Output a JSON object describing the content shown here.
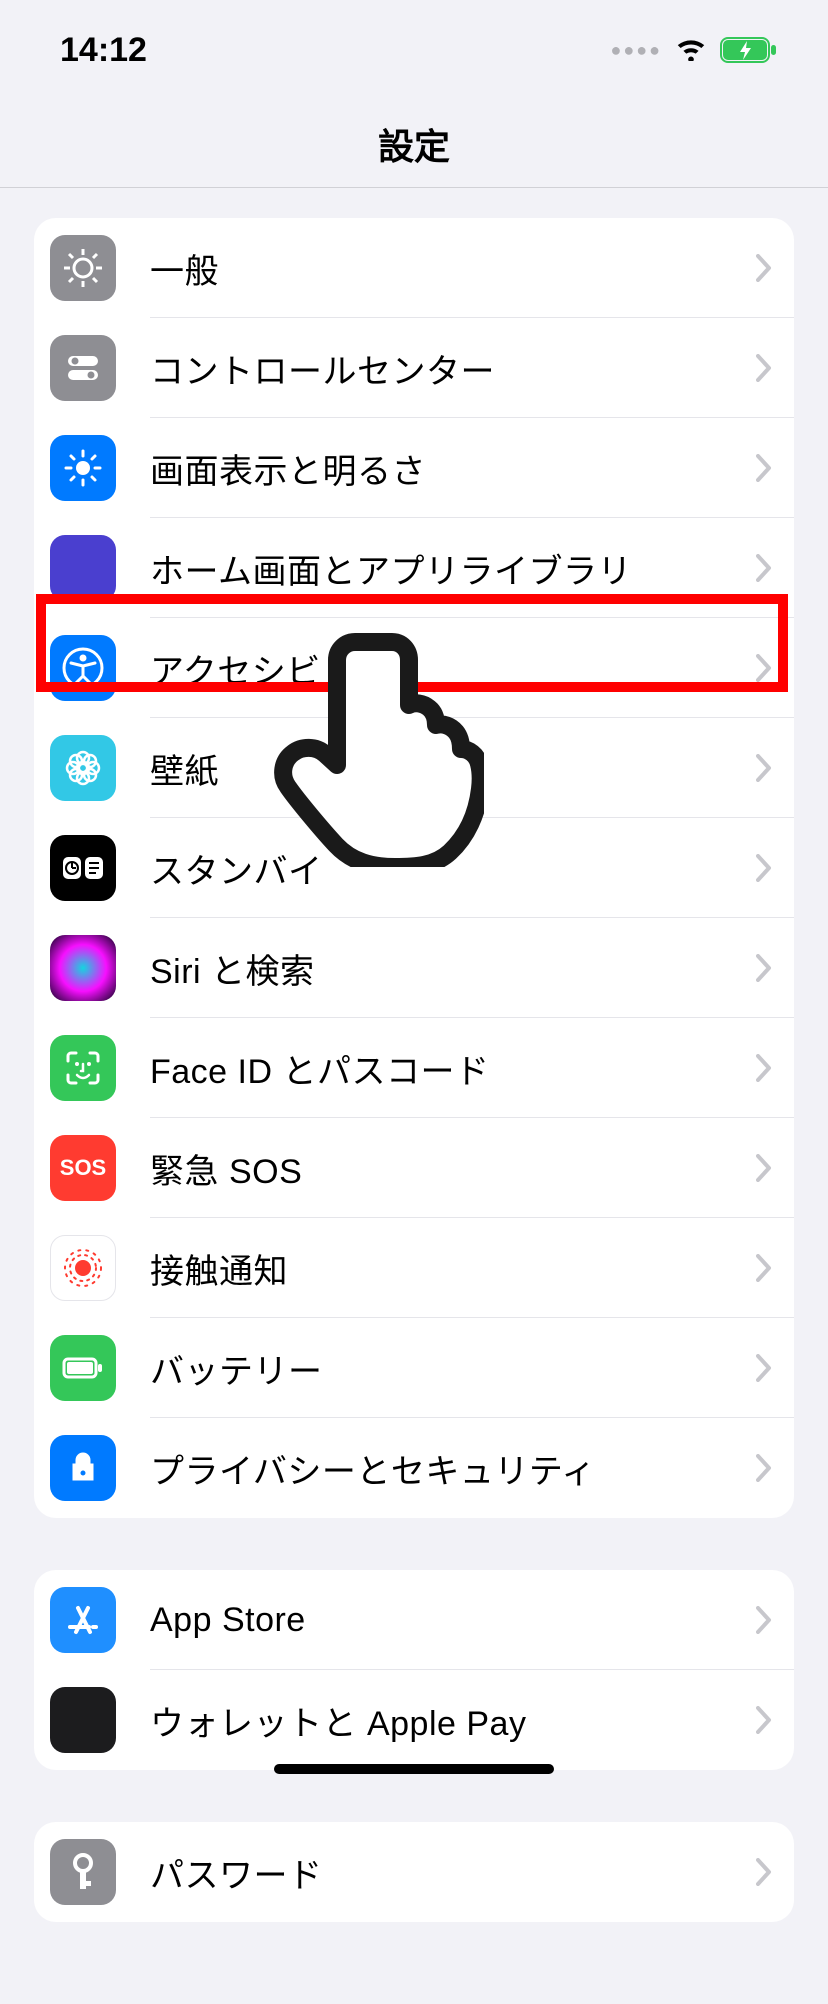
{
  "status": {
    "time": "14:12"
  },
  "nav": {
    "title": "設定"
  },
  "groups": [
    {
      "items": [
        {
          "label": "一般",
          "icon": "gear-icon"
        },
        {
          "label": "コントロールセンター",
          "icon": "switches-icon"
        },
        {
          "label": "画面表示と明るさ",
          "icon": "brightness-icon"
        },
        {
          "label": "ホーム画面とアプリライブラリ",
          "icon": "home-grid-icon"
        },
        {
          "label": "アクセシビリティ",
          "icon": "accessibility-icon",
          "highlighted": true
        },
        {
          "label": "壁紙",
          "icon": "wallpaper-icon"
        },
        {
          "label": "スタンバイ",
          "icon": "standby-icon"
        },
        {
          "label": "Siri と検索",
          "icon": "siri-icon"
        },
        {
          "label": "Face ID とパスコード",
          "icon": "faceid-icon"
        },
        {
          "label": "緊急 SOS",
          "icon": "sos-icon"
        },
        {
          "label": "接触通知",
          "icon": "exposure-icon"
        },
        {
          "label": "バッテリー",
          "icon": "battery-icon"
        },
        {
          "label": "プライバシーとセキュリティ",
          "icon": "privacy-icon"
        }
      ]
    },
    {
      "items": [
        {
          "label": "App Store",
          "icon": "appstore-icon"
        },
        {
          "label": "ウォレットと Apple Pay",
          "icon": "wallet-icon"
        }
      ]
    },
    {
      "items": [
        {
          "label": "パスワード",
          "icon": "key-icon"
        }
      ]
    }
  ],
  "annotation": {
    "highlight_color": "#ff0000",
    "hand_cursor": true,
    "target": "アクセシビリティ"
  }
}
